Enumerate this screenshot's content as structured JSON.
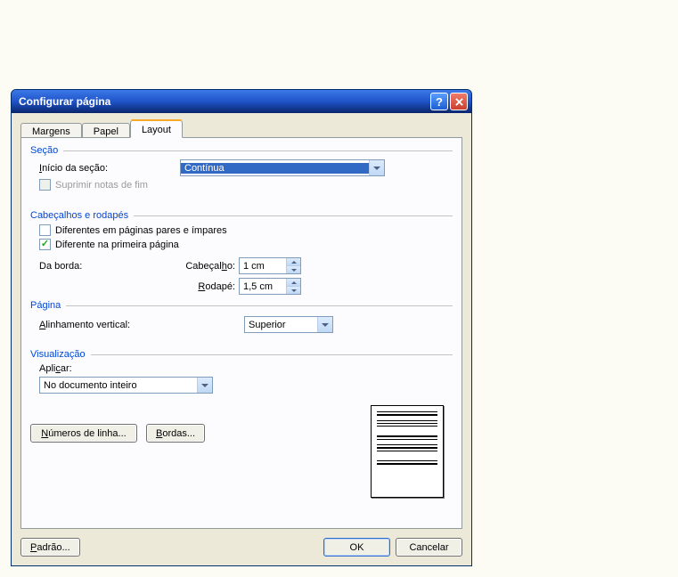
{
  "title": "Configurar página",
  "tabs": {
    "margins": "Margens",
    "paper": "Papel",
    "layout": "Layout"
  },
  "section": {
    "legend": "Seção",
    "start_label": "Início da seção:",
    "start_value": "Contínua",
    "suppress_endnotes": "Suprimir notas de fim"
  },
  "headersFooters": {
    "legend": "Cabeçalhos e rodapés",
    "diff_odd_even": "Diferentes em páginas pares e ímpares",
    "diff_first": "Diferente na primeira página",
    "from_edge_label": "Da borda:",
    "header_label": "Cabeçalho:",
    "header_value": "1 cm",
    "footer_label": "Rodapé:",
    "footer_value": "1,5 cm"
  },
  "page": {
    "legend": "Página",
    "valign_label": "Alinhamento vertical:",
    "valign_value": "Superior"
  },
  "preview": {
    "legend": "Visualização",
    "apply_label": "Aplicar:",
    "apply_value": "No documento inteiro",
    "line_numbers": "Números de linha...",
    "borders": "Bordas..."
  },
  "buttons": {
    "default_btn": "Padrão...",
    "ok": "OK",
    "cancel": "Cancelar"
  }
}
